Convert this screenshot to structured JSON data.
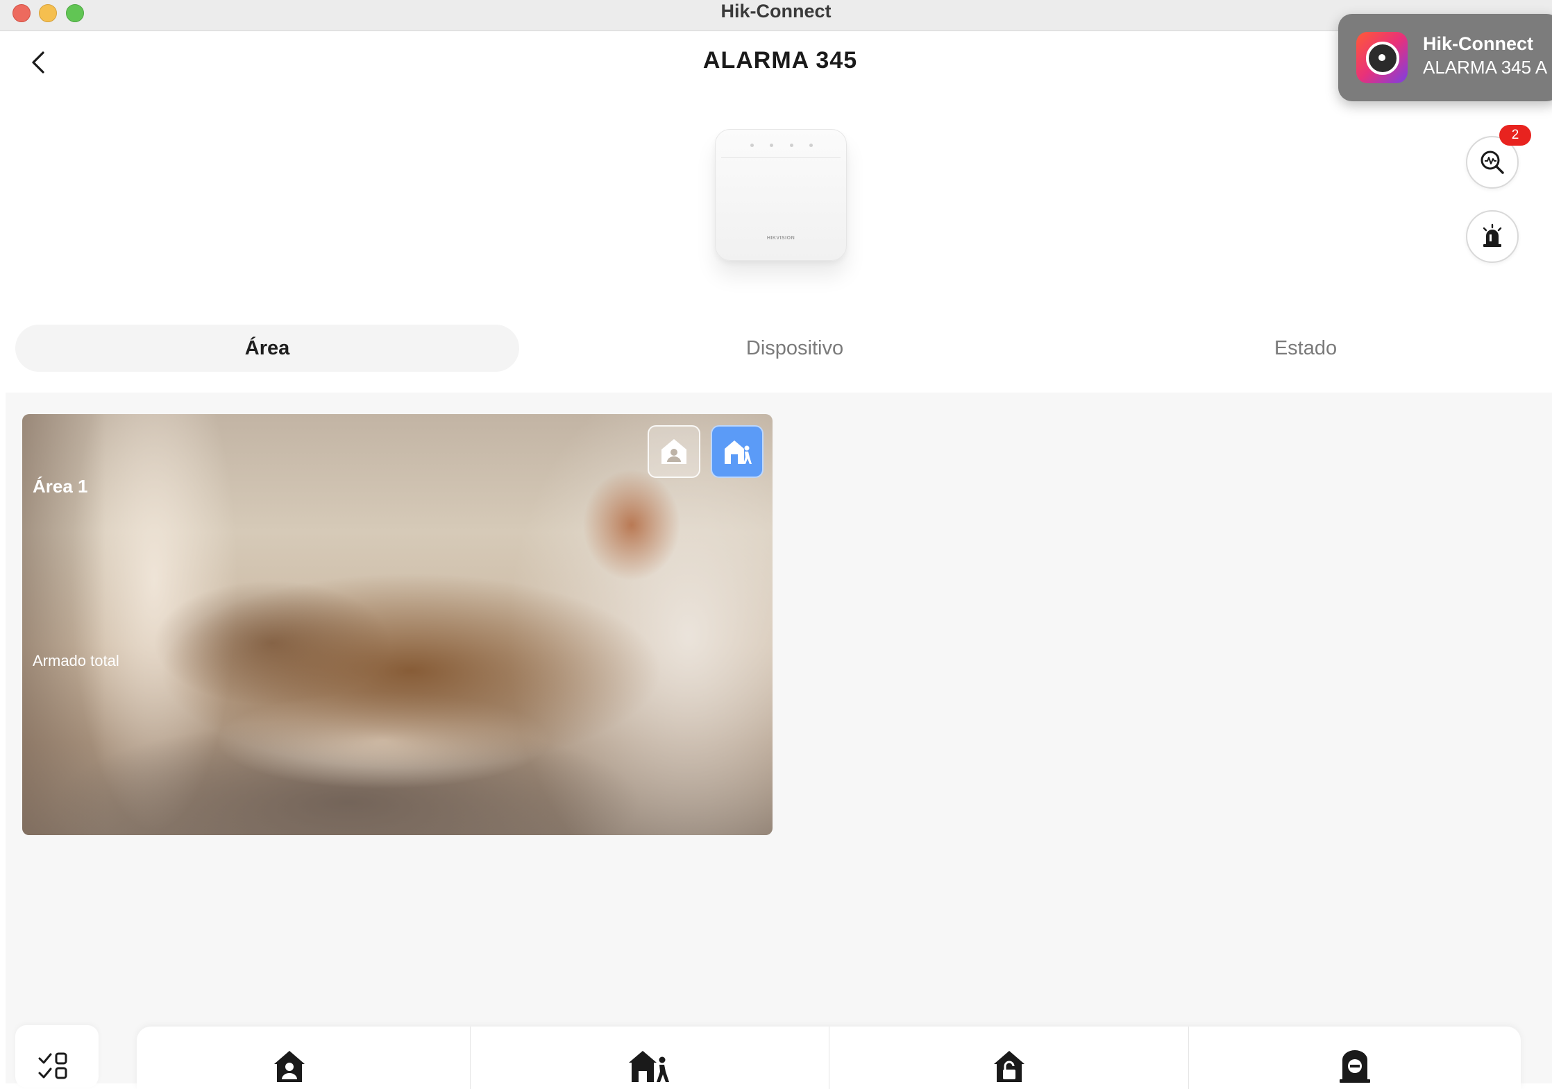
{
  "window": {
    "title": "Hik-Connect"
  },
  "header": {
    "title": "ALARMA 345"
  },
  "device": {
    "brand": "HIKVISION"
  },
  "notification": {
    "app": "Hik-Connect",
    "message": "ALARMA 345 A"
  },
  "actions": {
    "diagnostic_badge": "2"
  },
  "tabs": [
    {
      "label": "Área",
      "active": true
    },
    {
      "label": "Dispositivo",
      "active": false
    },
    {
      "label": "Estado",
      "active": false
    }
  ],
  "areas": [
    {
      "name": "Área 1",
      "status": "Armado total"
    }
  ],
  "colors": {
    "accent": "#5b9bf7",
    "badge": "#e8231f",
    "background": "#f7f7f7"
  },
  "bottom_bar": {
    "side_icon": "checklist-icon",
    "items": [
      "stay-arm-icon",
      "away-arm-icon",
      "disarm-icon",
      "clear-alarm-icon"
    ]
  }
}
